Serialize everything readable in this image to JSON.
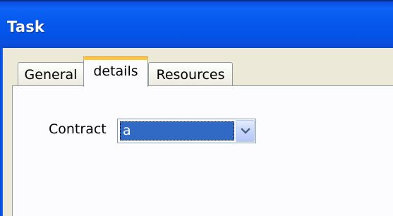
{
  "window": {
    "title": "Task"
  },
  "tabs": [
    {
      "label": "General",
      "selected": false
    },
    {
      "label": "details",
      "selected": true
    },
    {
      "label": "Resources",
      "selected": false
    }
  ],
  "form": {
    "contract_label": "Contract",
    "contract_value": "a",
    "dropdown_icon": "chevron-down-icon"
  },
  "colors": {
    "titlebar": "#0559ec",
    "selection": "#316ac5",
    "active_tab_highlight": "#ffc83c"
  }
}
